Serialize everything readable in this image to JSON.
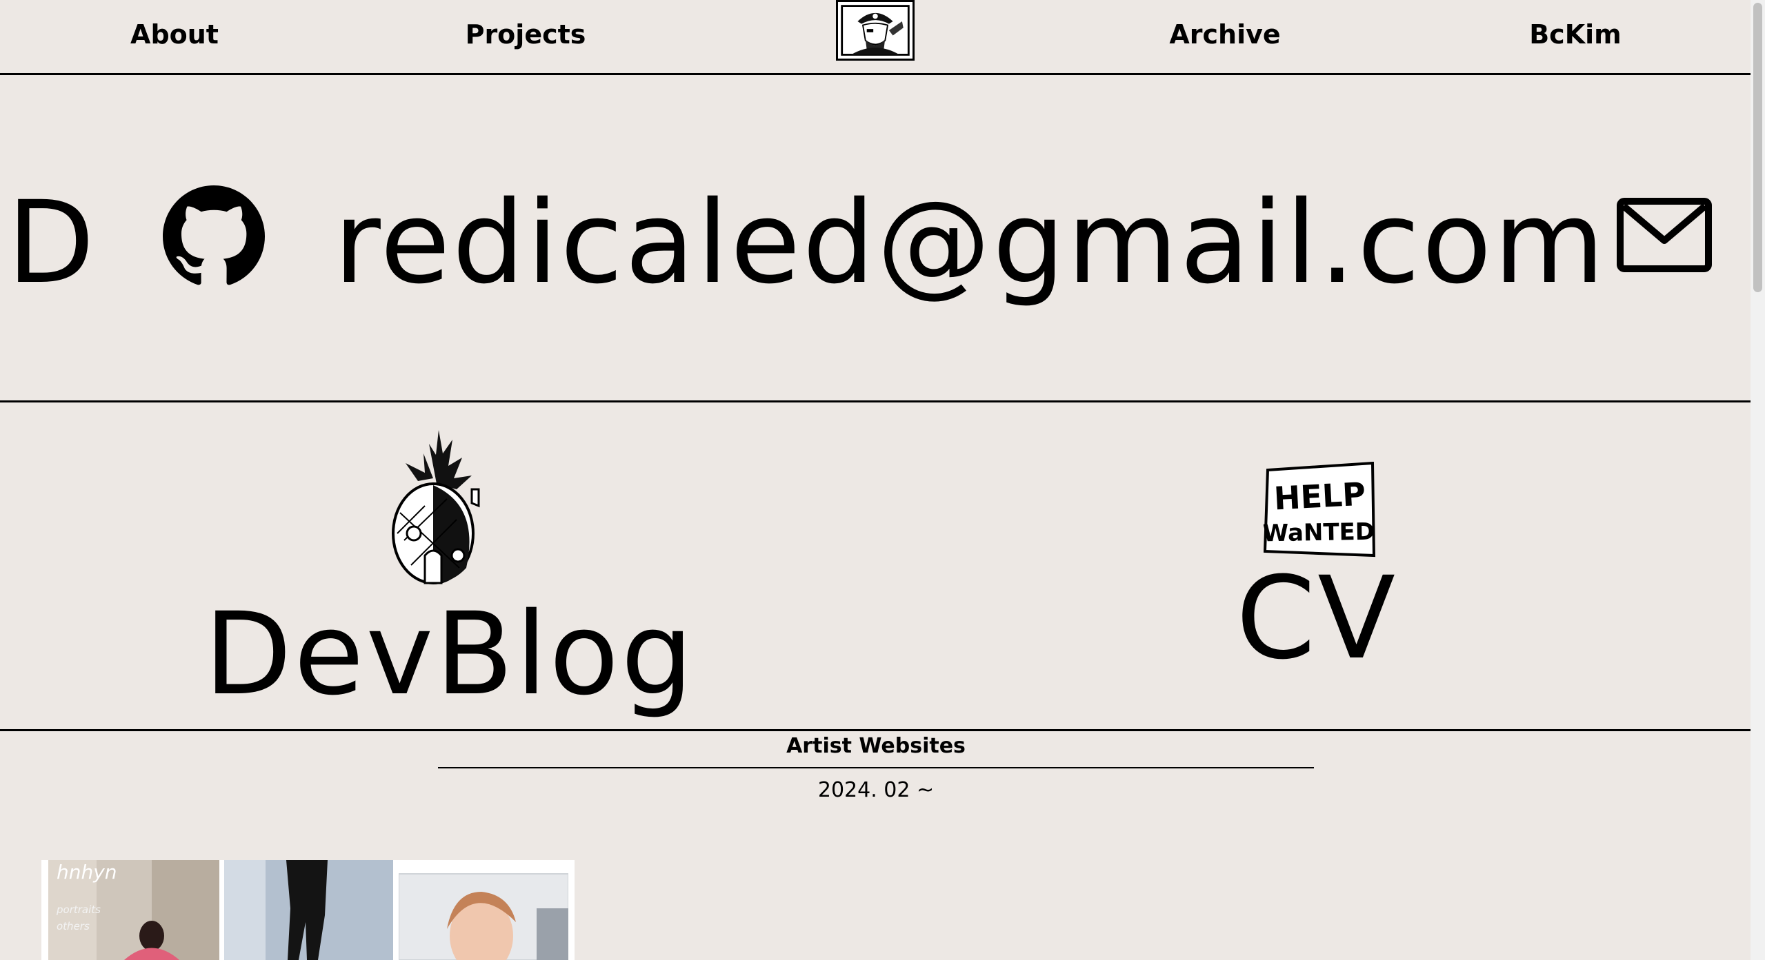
{
  "nav": {
    "links": [
      {
        "label": "About"
      },
      {
        "label": "Projects"
      },
      {
        "label": "Archive"
      },
      {
        "label": "BcKim"
      }
    ],
    "logo_icon": "pirate-portrait-icon"
  },
  "contact": {
    "marquee_prefix": "D",
    "email": "redicaled@gmail.com",
    "github_icon": "github-icon",
    "mail_icon": "mail-icon"
  },
  "links_row": {
    "devblog": {
      "label": "DevBlog",
      "icon": "pineapple-house-icon"
    },
    "cv": {
      "label": "CV",
      "icon": "help-wanted-sign-icon"
    },
    "help_sign_line1": "HELP",
    "help_sign_line2": "WaNTED"
  },
  "section": {
    "title": "Artist Websites",
    "date": "2024. 02 ~",
    "gallery": {
      "caption": "hnhyn",
      "menu": [
        "portraits",
        "others"
      ]
    }
  },
  "colors": {
    "background": "#ede8e4",
    "ink": "#000000"
  }
}
